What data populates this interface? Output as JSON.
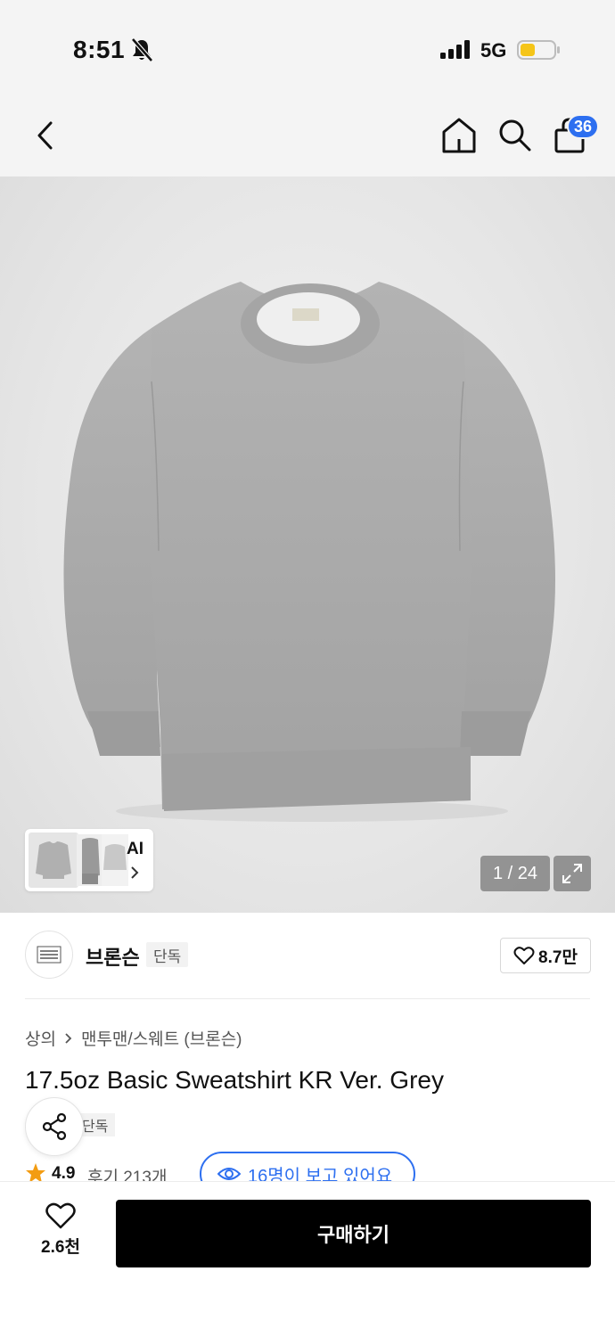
{
  "status_bar": {
    "time": "8:51",
    "network": "5G"
  },
  "header": {
    "cart_count": "36"
  },
  "gallery": {
    "ai_label": "AI",
    "counter": "1 / 24"
  },
  "brand": {
    "name": "브론슨",
    "tag": "단독",
    "likes": "8.7만"
  },
  "breadcrumb": {
    "category": "상의",
    "subcategory": "맨투맨/스웨트 (브론슨)"
  },
  "product": {
    "title": "17.5oz Basic Sweatshirt KR Ver. Grey",
    "exclusive_tag": "단독",
    "rating": "4.9",
    "reviews": "후기 213개",
    "viewers": "16명이 보고 있어요"
  },
  "bottom_bar": {
    "wish_count": "2.6천",
    "buy_label": "구매하기"
  },
  "colors": {
    "accent": "#2d6ff0",
    "buy_button": "#000000",
    "garment": "#a9a9a9"
  }
}
